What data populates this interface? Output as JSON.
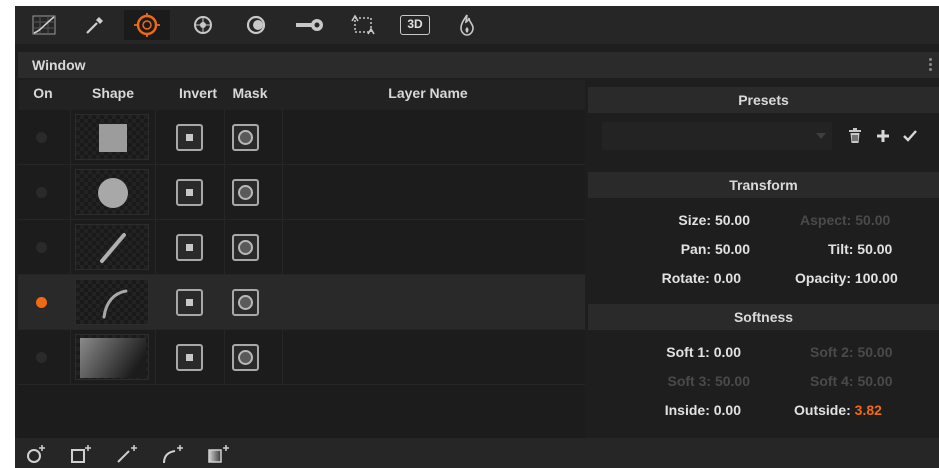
{
  "toolbar": {
    "tools": [
      {
        "name": "curves-icon",
        "active": false
      },
      {
        "name": "qualifier-eyedropper-icon",
        "active": false
      },
      {
        "name": "window-icon",
        "active": true
      },
      {
        "name": "tracker-icon",
        "active": false
      },
      {
        "name": "blur-icon",
        "active": false
      },
      {
        "name": "key-icon",
        "active": false
      },
      {
        "name": "sizing-icon",
        "active": false
      },
      {
        "name": "3d-icon",
        "label": "3D",
        "active": false
      },
      {
        "name": "fx-flame-icon",
        "active": false
      }
    ],
    "accent_color": "#f06a16"
  },
  "window": {
    "title": "Window"
  },
  "table": {
    "headers": {
      "on": "On",
      "shape": "Shape",
      "invert": "Invert",
      "mask": "Mask",
      "layer_name": "Layer Name"
    },
    "rows": [
      {
        "shape": "square",
        "on": false,
        "selected": false,
        "layer_name": ""
      },
      {
        "shape": "circle",
        "on": false,
        "selected": false,
        "layer_name": ""
      },
      {
        "shape": "linear",
        "on": false,
        "selected": false,
        "layer_name": ""
      },
      {
        "shape": "curve",
        "on": true,
        "selected": true,
        "layer_name": ""
      },
      {
        "shape": "gradient",
        "on": false,
        "selected": false,
        "layer_name": ""
      }
    ]
  },
  "presets": {
    "title": "Presets",
    "selected": "",
    "delete_icon": "trash-icon",
    "add_icon": "plus-icon",
    "apply_icon": "check-icon"
  },
  "transform": {
    "title": "Transform",
    "size_label": "Size:",
    "size_value": "50.00",
    "aspect_label": "Aspect:",
    "aspect_value": "50.00",
    "pan_label": "Pan:",
    "pan_value": "50.00",
    "tilt_label": "Tilt:",
    "tilt_value": "50.00",
    "rotate_label": "Rotate:",
    "rotate_value": "0.00",
    "opacity_label": "Opacity:",
    "opacity_value": "100.00"
  },
  "softness": {
    "title": "Softness",
    "soft1_label": "Soft 1:",
    "soft1_value": "0.00",
    "soft2_label": "Soft 2:",
    "soft2_value": "50.00",
    "soft3_label": "Soft 3:",
    "soft3_value": "50.00",
    "soft4_label": "Soft 4:",
    "soft4_value": "50.00",
    "inside_label": "Inside:",
    "inside_value": "0.00",
    "outside_label": "Outside:",
    "outside_value": "3.82"
  },
  "bottom_tools": [
    "add-circle-window-icon",
    "add-square-window-icon",
    "add-linear-window-icon",
    "add-curve-window-icon",
    "add-gradient-window-icon"
  ]
}
